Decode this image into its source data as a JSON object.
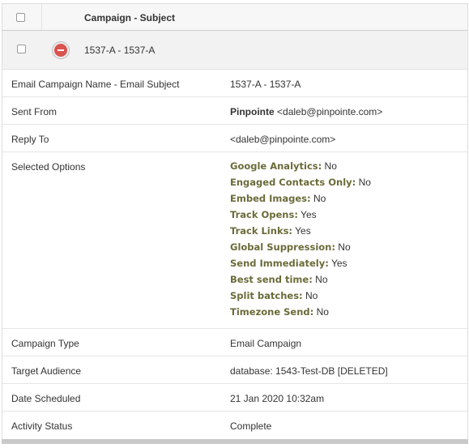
{
  "header": {
    "title": "Campaign - Subject"
  },
  "item": {
    "name": "1537-A - 1537-A"
  },
  "details": {
    "name_label": "Email Campaign Name - Email Subject",
    "name_value": "1537-A - 1537-A",
    "sent_from_label": "Sent From",
    "sent_from_name": "Pinpointe",
    "sent_from_email": "<daleb@pinpointe.com>",
    "reply_to_label": "Reply To",
    "reply_to_value": "<daleb@pinpointe.com>",
    "options_label": "Selected Options",
    "options": [
      {
        "key": "Google Analytics:",
        "value": "No"
      },
      {
        "key": "Engaged Contacts Only:",
        "value": "No"
      },
      {
        "key": "Embed Images:",
        "value": "No"
      },
      {
        "key": "Track Opens:",
        "value": "Yes"
      },
      {
        "key": "Track Links:",
        "value": "Yes"
      },
      {
        "key": "Global Suppression:",
        "value": "No"
      },
      {
        "key": "Send Immediately:",
        "value": "Yes"
      },
      {
        "key": "Best send time:",
        "value": "No"
      },
      {
        "key": "Split batches:",
        "value": "No"
      },
      {
        "key": "Timezone Send:",
        "value": "No"
      }
    ],
    "campaign_type_label": "Campaign Type",
    "campaign_type_value": "Email Campaign",
    "target_label": "Target Audience",
    "target_value": "database: 1543-Test-DB [DELETED]",
    "date_label": "Date Scheduled",
    "date_value": "21 Jan 2020 10:32am",
    "status_label": "Activity Status",
    "status_value": "Complete"
  },
  "colors": {
    "remove": "#d9534f",
    "option_key": "#6b6b3a"
  }
}
